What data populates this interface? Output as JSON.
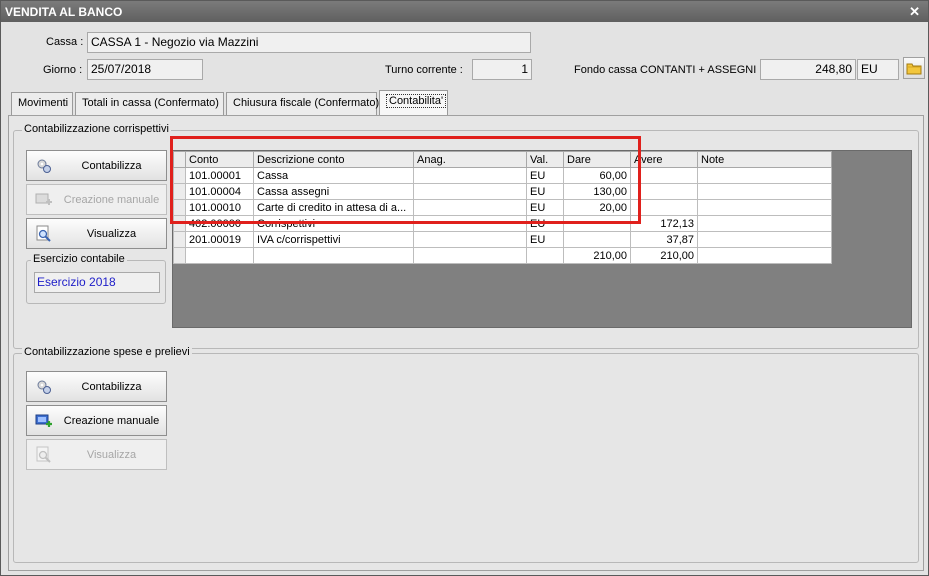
{
  "window": {
    "title": "VENDITA AL BANCO",
    "close_glyph": "✕"
  },
  "header": {
    "cassa_label": "Cassa :",
    "cassa_value": "CASSA 1 - Negozio via Mazzini",
    "giorno_label": "Giorno :",
    "giorno_value": "25/07/2018",
    "turno_label": "Turno corrente :",
    "turno_value": "1",
    "fondo_label": "Fondo cassa CONTANTI + ASSEGNI :",
    "fondo_value": "248,80",
    "fondo_currency": "EU",
    "folder_icon": "folder-icon"
  },
  "tabs": [
    {
      "label": "Movimenti",
      "active": false
    },
    {
      "label": "Totali in cassa (Confermato)",
      "active": false
    },
    {
      "label": "Chiusura fiscale (Confermato)",
      "active": false
    },
    {
      "label": "Contabilita'",
      "active": true
    }
  ],
  "corrispettivi": {
    "group_title": "Contabilizzazione corrispettivi",
    "buttons": {
      "contabilizza": "Contabilizza",
      "creazione_manuale": "Creazione manuale",
      "visualizza": "Visualizza"
    },
    "esercizio_title": "Esercizio contabile",
    "esercizio_value": "Esercizio 2018",
    "grid": {
      "columns": [
        "Conto",
        "Descrizione conto",
        "Anag.",
        "Val.",
        "Dare",
        "Avere",
        "Note"
      ],
      "rows": [
        [
          "101.00001",
          "Cassa",
          "",
          "EU",
          "60,00",
          "",
          ""
        ],
        [
          "101.00004",
          "Cassa assegni",
          "",
          "EU",
          "130,00",
          "",
          ""
        ],
        [
          "101.00010",
          "Carte di credito in attesa di a...",
          "",
          "EU",
          "20,00",
          "",
          ""
        ],
        [
          "402.00000",
          "Corrispettivi",
          "",
          "EU",
          "",
          "172,13",
          ""
        ],
        [
          "201.00019",
          "IVA c/corrispettivi",
          "",
          "EU",
          "",
          "37,87",
          ""
        ],
        [
          "",
          "",
          "",
          "",
          "210,00",
          "210,00",
          ""
        ]
      ]
    }
  },
  "spese": {
    "group_title": "Contabilizzazione spese e prelievi",
    "buttons": {
      "contabilizza": "Contabilizza",
      "creazione_manuale": "Creazione manuale",
      "visualizza": "Visualizza"
    }
  },
  "colors": {
    "highlight": "#e0201c",
    "esercizio_text": "#1d1dc8",
    "grid_bg": "#808080"
  }
}
